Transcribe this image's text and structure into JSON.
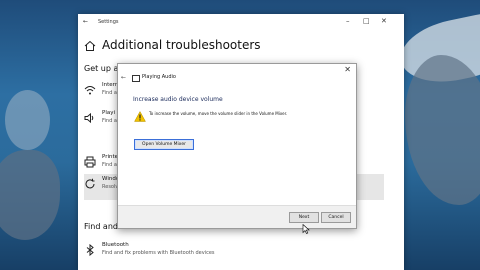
{
  "settings": {
    "app_title": "Settings",
    "page_title": "Additional troubleshooters",
    "section_getup": "Get up a",
    "section_find": "Find and",
    "items": [
      {
        "name": "Intern",
        "desc": "Find a"
      },
      {
        "name": "Playi",
        "desc": "Find a"
      },
      {
        "name": "Printe",
        "desc": "Find a"
      },
      {
        "name": "Windo",
        "desc": "Resolv"
      },
      {
        "name": "Bluetooth",
        "desc": "Find and fix problems with Bluetooth devices"
      }
    ]
  },
  "dialog": {
    "title": "Playing Audio",
    "heading": "Increase audio device volume",
    "message": "To increase the volume, move the volume slider in the Volume Mixer.",
    "mixer_button": "Open Volume Mixer",
    "next_button": "Next",
    "cancel_button": "Cancel"
  },
  "colors": {
    "accent": "#3b6fd8",
    "warning": "#f2c200"
  }
}
